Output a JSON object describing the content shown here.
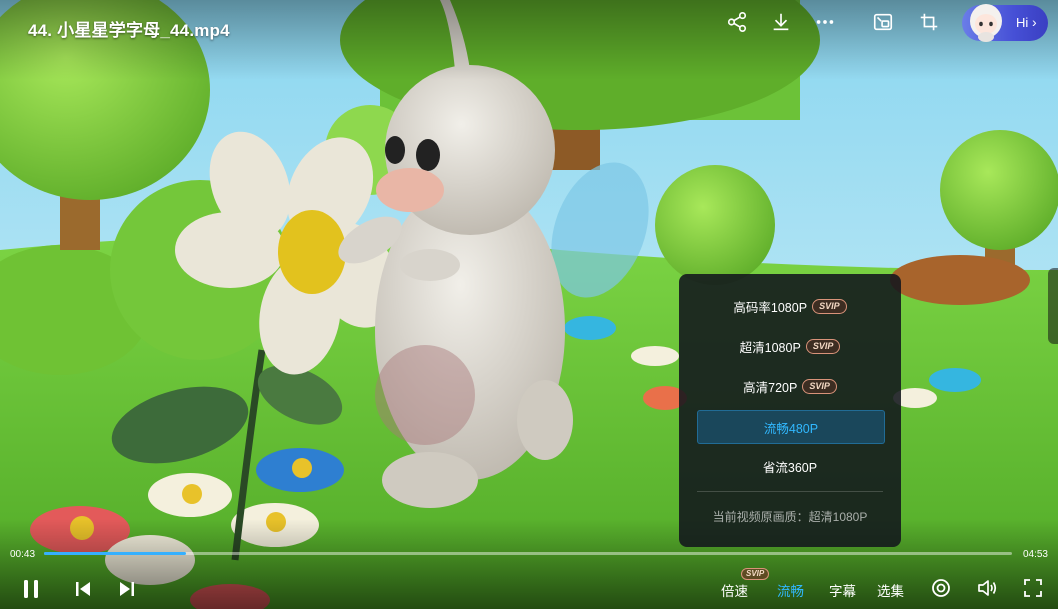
{
  "video": {
    "title": "44. 小星星学字母_44.mp4",
    "current_time": "00:43",
    "total_time": "04:53",
    "progress_fraction": 0.147
  },
  "top_bar": {
    "icons": [
      "share-icon",
      "download-icon",
      "more-icon",
      "picture-in-picture-icon",
      "crop-icon"
    ],
    "hi_label": "Hi",
    "hi_chevron": "›"
  },
  "quality_menu": {
    "options": [
      {
        "label": "高码率1080P",
        "badge": "SVIP"
      },
      {
        "label": "超清1080P",
        "badge": "SVIP"
      },
      {
        "label": "高清720P",
        "badge": "SVIP"
      },
      {
        "label": "流畅480P",
        "badge": ""
      },
      {
        "label": "省流360P",
        "badge": ""
      }
    ],
    "selected_index": 3,
    "original_quality": "当前视频原画质：超清1080P"
  },
  "controls": {
    "speed_label": "倍速",
    "speed_badge": "SVIP",
    "quality_label": "流畅",
    "subtitle_label": "字幕",
    "episodes_label": "选集"
  },
  "colors": {
    "accent": "#31b8ff",
    "progress": "#35b0ff",
    "hi_pill": "#4650d6"
  }
}
